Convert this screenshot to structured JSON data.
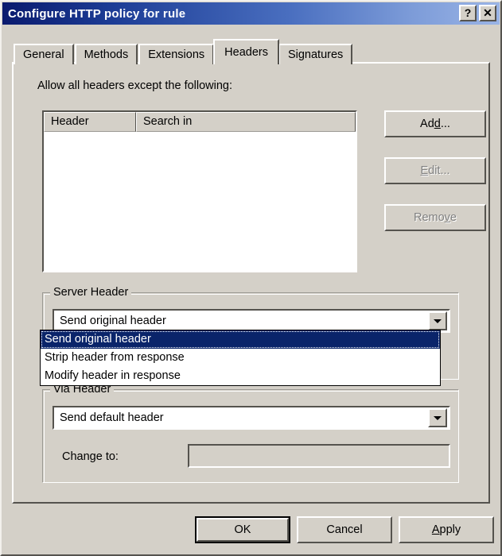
{
  "window": {
    "title": "Configure HTTP policy for rule",
    "help_button": "?",
    "close_button": "✕",
    "titlebar_gradient_start": "#0a1a6e",
    "titlebar_gradient_end": "#9ab4e6",
    "face_color": "#d4d0c8"
  },
  "tabs": [
    {
      "label": "General",
      "active": false
    },
    {
      "label": "Methods",
      "active": false
    },
    {
      "label": "Extensions",
      "active": false
    },
    {
      "label": "Headers",
      "active": true
    },
    {
      "label": "Signatures",
      "active": false
    }
  ],
  "headers_page": {
    "allow_label": "Allow all headers except the following:",
    "list": {
      "columns": [
        "Header",
        "Search in"
      ],
      "rows": []
    },
    "buttons": [
      {
        "label_before": "Ad",
        "accel": "d",
        "label_after": "...",
        "name": "add-button",
        "enabled": true
      },
      {
        "label_before": "",
        "accel": "E",
        "label_after": "dit...",
        "name": "edit-button",
        "enabled": false
      },
      {
        "label_before": "Remo",
        "accel": "v",
        "label_after": "e",
        "name": "remove-button",
        "enabled": false
      }
    ],
    "server_header": {
      "group_title": "Server Header",
      "selected": "Send original header",
      "open": true,
      "options": [
        {
          "label": "Send original header",
          "selected": true
        },
        {
          "label": "Strip header from response",
          "selected": false
        },
        {
          "label": "Modify header in response",
          "selected": false
        }
      ],
      "highlight_color": "#0a246a"
    },
    "via_header": {
      "group_title": "Via Header",
      "selected": "Send default header",
      "change_to_label": "Change to:",
      "change_to_value": "",
      "change_to_enabled": false
    }
  },
  "footer": {
    "ok": "OK",
    "cancel": "Cancel",
    "apply_accel": "A",
    "apply_rest": "pply"
  }
}
